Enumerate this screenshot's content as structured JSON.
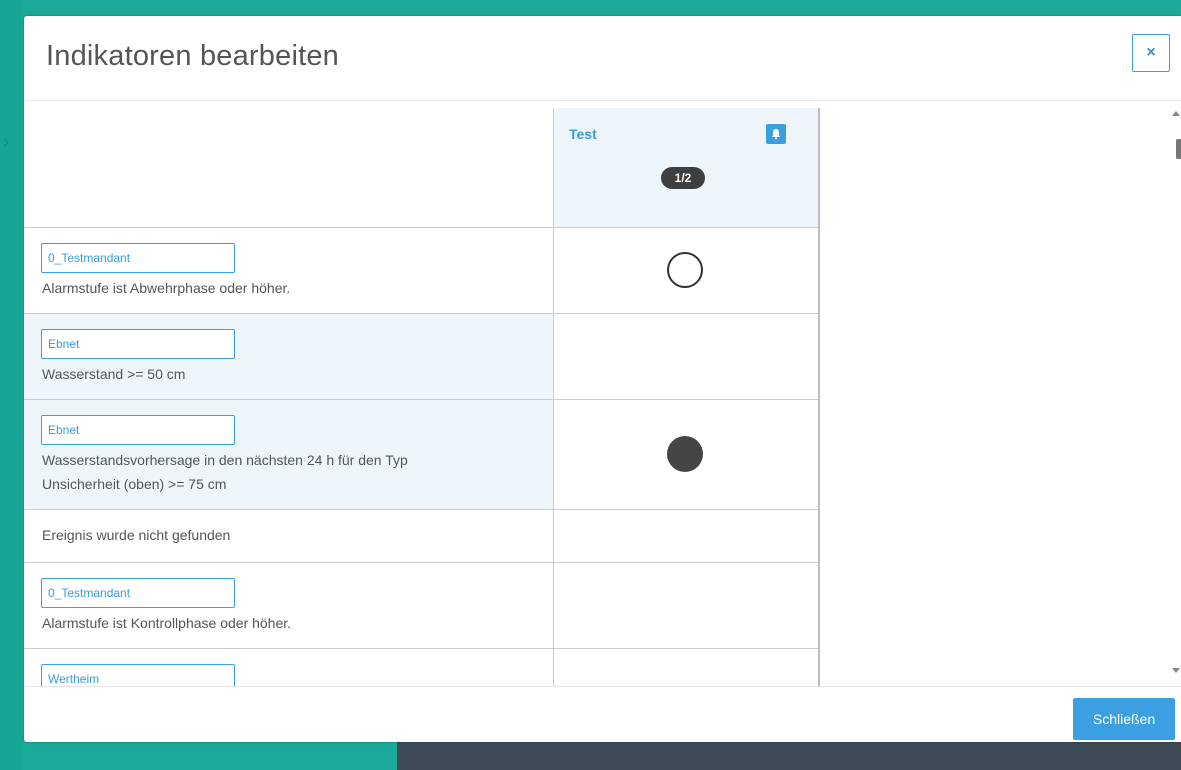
{
  "dialog": {
    "title": "Indikatoren bearbeiten",
    "close_icon": "×"
  },
  "column": {
    "name": "Test",
    "bell_icon": "bell-icon",
    "count": "1/2"
  },
  "rows": [
    {
      "tag": "0_Testmandant",
      "desc": "Alarmstufe ist Abwehrphase oder höher.",
      "status": "empty"
    },
    {
      "tag": "Ebnet",
      "desc": "Wasserstand >= 50 cm",
      "status": "none"
    },
    {
      "tag": "Ebnet",
      "desc_line1": "Wasserstandsvorhersage in den nächsten 24 h für den Typ",
      "desc_line2": "Unsicherheit (oben) >= 75 cm",
      "status": "filled"
    },
    {
      "desc": "Ereignis wurde nicht gefunden",
      "status": "none"
    },
    {
      "tag": "0_Testmandant",
      "desc": "Alarmstufe ist Kontrollphase oder höher.",
      "status": "none"
    },
    {
      "tag": "Wertheim",
      "status": "none"
    }
  ],
  "footer": {
    "close_label": "Schließen"
  },
  "colors": {
    "accent": "#3aa0e2",
    "highlight": "#eef6fc",
    "background": "#1ba99a"
  }
}
